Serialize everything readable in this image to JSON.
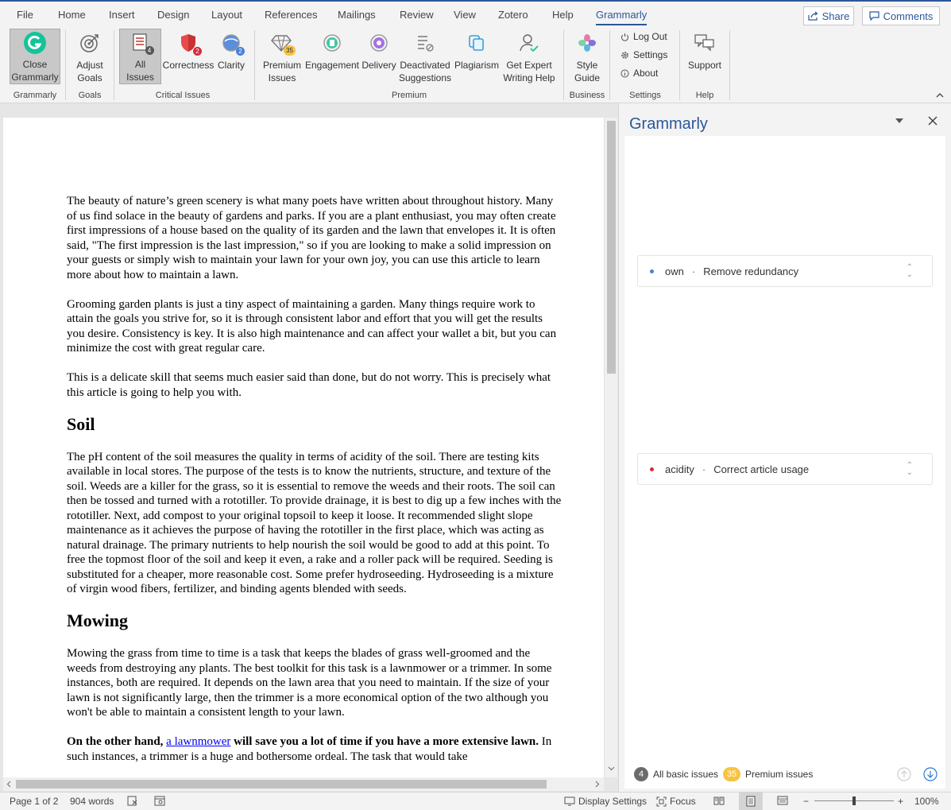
{
  "menu": {
    "tabs": [
      "File",
      "Home",
      "Insert",
      "Design",
      "Layout",
      "References",
      "Mailings",
      "Review",
      "View",
      "Zotero",
      "Help",
      "Grammarly"
    ],
    "active_tab": "Grammarly",
    "share_label": "Share",
    "comments_label": "Comments"
  },
  "ribbon": {
    "close_grammarly": [
      "Close",
      "Grammarly"
    ],
    "adjust_goals": [
      "Adjust",
      "Goals"
    ],
    "all_issues": "All Issues",
    "all_issues_count": "4",
    "correctness": "Correctness",
    "correctness_count": "2",
    "clarity": "Clarity",
    "clarity_count": "2",
    "premium_issues": [
      "Premium",
      "Issues"
    ],
    "premium_count": "35",
    "engagement": "Engagement",
    "delivery": "Delivery",
    "deactivated": [
      "Deactivated",
      "Suggestions"
    ],
    "plagiarism": "Plagiarism",
    "expert": [
      "Get Expert",
      "Writing Help"
    ],
    "style_guide": [
      "Style",
      "Guide"
    ],
    "log_out": "Log Out",
    "settings": "Settings",
    "about": "About",
    "support": "Support",
    "groups": {
      "grammarly": "Grammarly",
      "goals": "Goals",
      "critical": "Critical Issues",
      "premium": "Premium",
      "business": "Business",
      "settings": "Settings",
      "help": "Help"
    }
  },
  "document": {
    "p1": "The beauty of nature’s green scenery is what many poets have written about throughout history. Many of us find solace in the beauty of gardens and parks. If you are a plant enthusiast, you may often create first impressions of a house based on the quality of its garden and the lawn that envelopes it. It is often said, \"The first impression is the last impression,\" so if you are looking to make a solid impression on your guests or simply wish to maintain your lawn for your own joy, you can use this article to learn more about how to maintain a lawn.",
    "p2": "Grooming garden plants is just a tiny aspect of maintaining a garden. Many things require work to attain the goals you strive for, so it is through consistent labor and effort that you will get the results you desire. Consistency is key. It is also high maintenance and can affect your wallet a bit, but you can minimize the cost with great regular care.",
    "p3": "This is a delicate skill that seems much easier said than done, but do not worry. This is precisely what this article is going to help you with.",
    "h_soil": "Soil",
    "p4": "The pH content of the soil measures the quality in terms of acidity of the soil. There are testing kits available in local stores. The purpose of the tests is to know the nutrients, structure, and texture of the soil. Weeds are a killer for the grass, so it is essential to remove the weeds and their roots. The soil can then be tossed and turned with a rototiller. To provide drainage, it is best to dig up a few inches with the rototiller. Next, add compost to your original topsoil to keep it loose. It recommended slight slope maintenance as it achieves the purpose of having the rototiller in the first place, which was acting as natural drainage. The primary nutrients to help nourish the soil would be good to add at this point. To free the topmost floor of the soil and keep it even, a rake and a roller pack will be required. Seeding is substituted for a cheaper, more reasonable cost. Some prefer hydroseeding. Hydroseeding is a mixture of virgin wood fibers, fertilizer, and binding agents blended with seeds.",
    "h_mowing": "Mowing",
    "p5": "Mowing the grass from time to time is a task that keeps the blades of grass well-groomed and the weeds from destroying any plants. The best toolkit for this task is a lawnmower or a trimmer. In some instances, both are required. It depends on the lawn area that you need to maintain. If the size of your lawn is not significantly large, then the trimmer is a more economical option of the two although you won't be able to maintain a consistent length to your lawn.",
    "p6_bold_a": "On the other hand,",
    "p6_link": "a lawnmower",
    "p6_bold_b": "will save you a lot of time if you have a more extensive lawn.",
    "p6_rest": "In such instances, a trimmer is a huge and bothersome ordeal. The task that would take"
  },
  "pane": {
    "title": "Grammarly",
    "cards": [
      {
        "word": "own",
        "issue": "Remove redundancy",
        "color": "#4a7fd8"
      },
      {
        "word": "acidity",
        "issue": "Correct article usage",
        "color": "#d62c3a"
      }
    ],
    "basic_count": "4",
    "basic_label": "All basic issues",
    "premium_count": "35",
    "premium_label": "Premium issues"
  },
  "status": {
    "page": "Page 1 of 2",
    "words": "904 words",
    "display_settings": "Display Settings",
    "focus": "Focus",
    "zoom": "100%",
    "zoom_minus": "−",
    "zoom_plus": "+"
  },
  "colors": {
    "accent": "#2b579a",
    "grammarly_green": "#15c39a",
    "premium_badge": "#f6c343",
    "correctness": "#d62c3a",
    "clarity": "#4a7fd8"
  }
}
